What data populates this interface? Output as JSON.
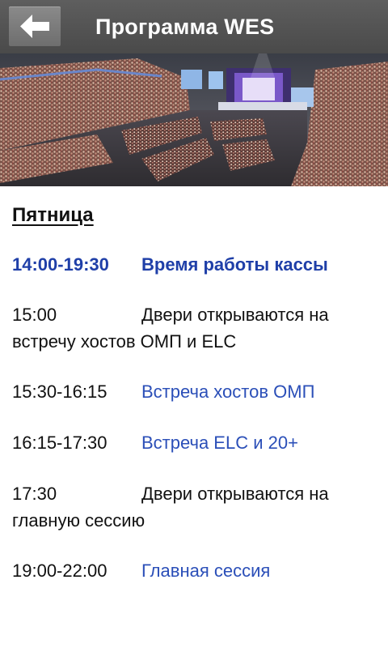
{
  "header": {
    "title": "Программа WES"
  },
  "schedule": {
    "day": "Пятница",
    "items": [
      {
        "time": "14:00-19:30",
        "desc": "Время работы кассы"
      },
      {
        "time": "15:00",
        "desc": "Двери открываются на",
        "desc2": "встречу хостов ОМП и ELC"
      },
      {
        "time": "15:30-16:15",
        "desc": "Встреча хостов ОМП"
      },
      {
        "time": "16:15-17:30",
        "desc": "Встреча ELC и 20+"
      },
      {
        "time": "17:30",
        "desc": "Двери открываются на",
        "desc2": "главную сессию"
      },
      {
        "time": "19:00-22:00",
        "desc": "Главная сессия"
      }
    ]
  },
  "colors": {
    "header_bg": "#555555",
    "link_blue": "#2b4fb8",
    "bold_blue": "#1f3fa8"
  },
  "icons": {
    "back": "arrow-left-icon"
  }
}
